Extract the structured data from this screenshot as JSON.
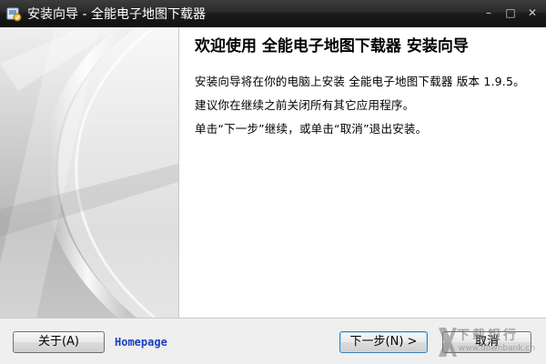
{
  "window": {
    "title": "安装向导 - 全能电子地图下载器",
    "controls": {
      "minimize": "–",
      "maximize": "□",
      "close": "✕"
    }
  },
  "content": {
    "heading": "欢迎使用 全能电子地图下载器 安装向导",
    "paragraphs": [
      "安装向导将在你的电脑上安装 全能电子地图下载器 版本 1.9.5。",
      "建议你在继续之前关闭所有其它应用程序。",
      "单击“下一步”继续，或单击“取消”退出安装。"
    ]
  },
  "footer": {
    "about_label": "关于(A)",
    "homepage_label": "Homepage",
    "next_label": "下一步(N) >",
    "cancel_label": "取消"
  },
  "watermark": {
    "main": "下载银行",
    "sub": "www.downbank.cn"
  },
  "icons": {
    "app": "installer-app-icon",
    "watermark_logo": "downbank-logo"
  }
}
